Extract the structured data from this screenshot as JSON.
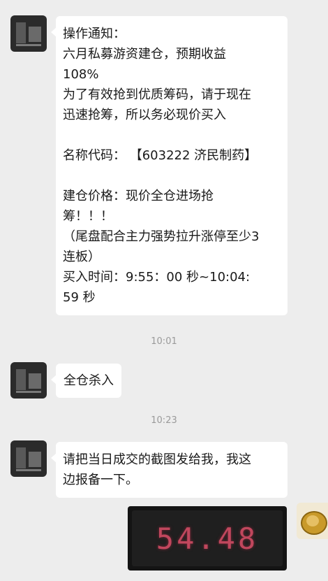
{
  "messages": [
    {
      "lines": [
        "操作通知：",
        "六月私募游资建仓，预期收益",
        "108%",
        "为了有效抢到优质筹码，请于现在",
        "迅速抢筹，所以务必现价买入",
        "",
        "名称代码：  【603222 济民制药】",
        "",
        "建仓价格：现价全仓进场抢",
        "筹！！！",
        "（尾盘配合主力强势拉升涨停至少3",
        "连板）",
        "买入时间：9:55：00 秒~10:04:",
        "59 秒"
      ]
    },
    {
      "lines": [
        "全仓杀入"
      ]
    },
    {
      "lines": [
        "请把当日成交的截图发给我，我这",
        "边报备一下。"
      ]
    }
  ],
  "timestamps": [
    "10:01",
    "10:23"
  ],
  "screenshot_number": "54.48"
}
